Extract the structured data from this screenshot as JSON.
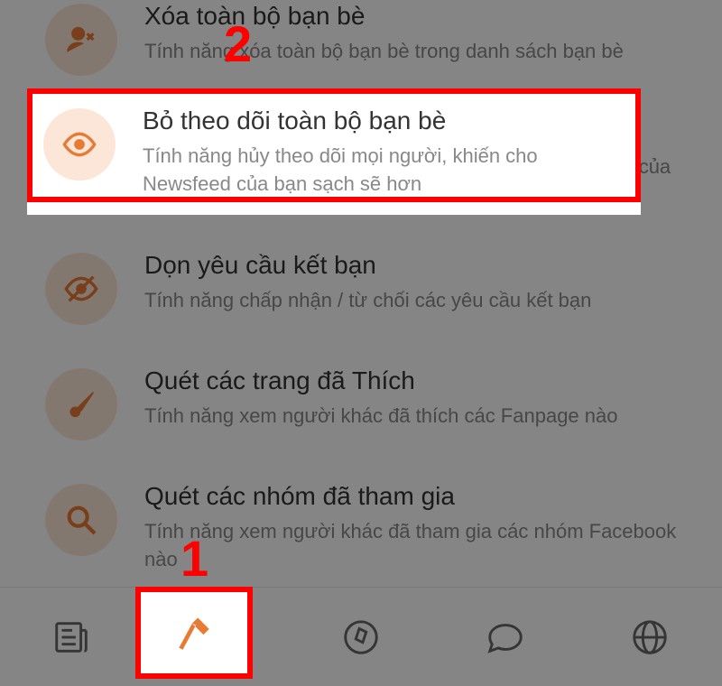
{
  "list": [
    {
      "title": "Xóa toàn bộ bạn bè",
      "desc": "Tính năng xóa toàn bộ bạn bè trong danh sách bạn bè"
    },
    {
      "title": "Bỏ theo dõi toàn bộ bạn bè",
      "desc": "Tính năng hủy theo dõi mọi người, khiến cho Newsfeed của bạn sạch sẽ hơn"
    },
    {
      "title": "Dọn yêu cầu kết bạn",
      "desc": "Tính năng chấp nhận / từ chối các yêu cầu kết bạn"
    },
    {
      "title": "Quét các trang đã Thích",
      "desc": "Tính năng xem người khác đã thích các Fanpage nào"
    },
    {
      "title": "Quét các nhóm đã tham gia",
      "desc": "Tính năng xem người khác đã tham gia các nhóm Facebook nào"
    }
  ],
  "callouts": {
    "one": "1",
    "two": "2"
  },
  "nav": {
    "feed": "feed",
    "tools": "tools",
    "compass": "compass",
    "chat": "chat",
    "globe": "globe"
  }
}
